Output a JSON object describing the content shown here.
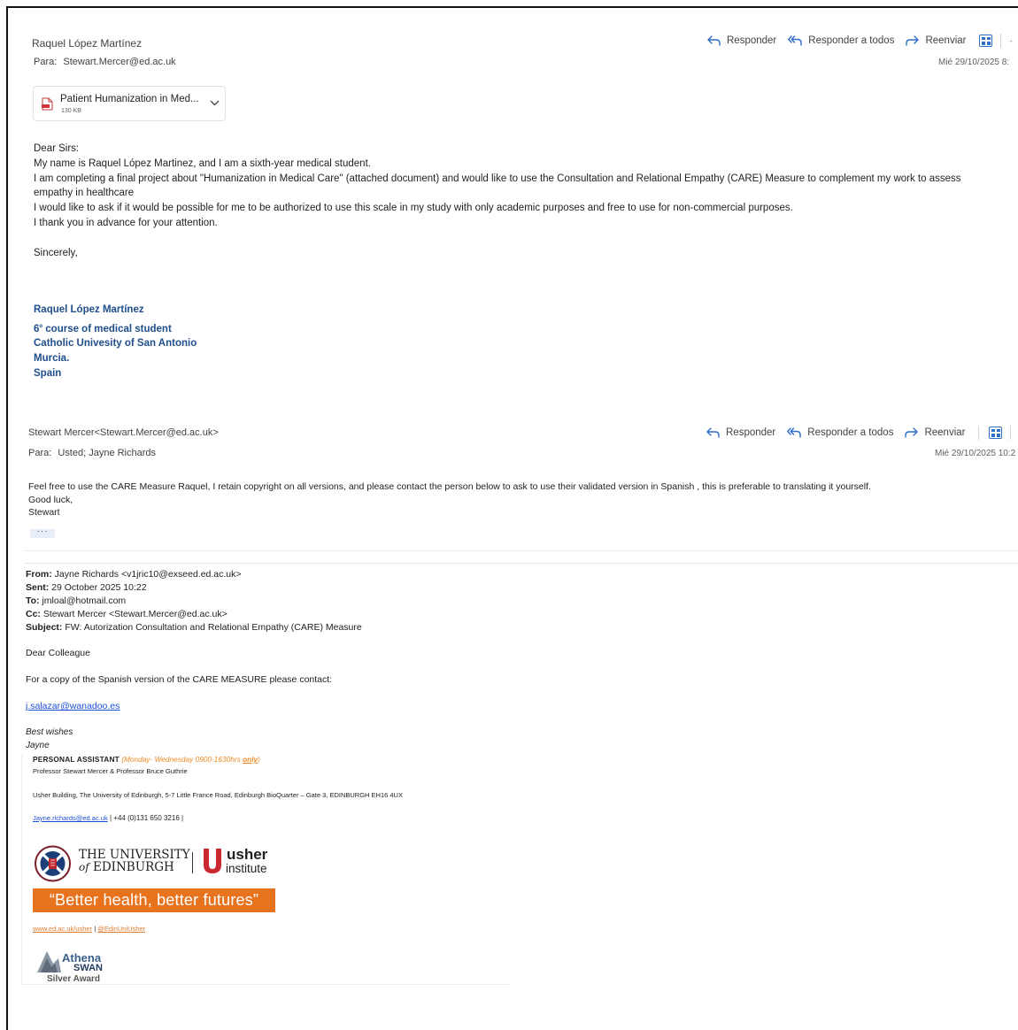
{
  "message1": {
    "sender": "Raquel López Martínez",
    "to_label": "Para:",
    "to": "Stewart.Mercer@ed.ac.uk",
    "date": "Mié 29/10/2025 8:",
    "actions": {
      "reply": "Responder",
      "reply_all": "Responder a todos",
      "forward": "Reenviar"
    },
    "attachment": {
      "name": "Patient Humanization in Med...",
      "size": "130 KB"
    },
    "body": [
      "Dear Sirs:",
      "My name is Raquel López Martinez, and I am a sixth-year medical student.",
      "I am completing a final project about \"Humanization in Medical Care\" (attached document) and would like to use the Consultation and Relational Empathy (CARE) Measure to complement my work to assess empathy in healthcare",
      "I would like to ask if it would be possible for me to be authorized to use this scale in my study with only academic purposes and free to use for non-commercial purposes.",
      "I thank you in advance for your attention."
    ],
    "closing": "Sincerely,",
    "signature": {
      "name": "Raquel López Martínez",
      "course_num": "6",
      "course_sup": "o",
      "course_rest": " course of medical student",
      "university": "Catholic Univesity of San Antonio",
      "city": "Murcia.",
      "country": "Spain"
    }
  },
  "message2": {
    "sender": "Stewart Mercer<Stewart.Mercer@ed.ac.uk>",
    "to_label": "Para:",
    "to": "Usted;  Jayne Richards",
    "date": "Mié 29/10/2025 10:2",
    "actions": {
      "reply": "Responder",
      "reply_all": "Responder a todos",
      "forward": "Reenviar"
    },
    "more": "···",
    "body": [
      "Feel free to use the CARE Measure Raquel, I retain copyright on all versions, and please contact the person below to ask to use their validated version in Spanish , this is preferable to translating it yourself.",
      "Good luck,",
      "Stewart"
    ],
    "expand": "···"
  },
  "quoted": {
    "from_label": "From:",
    "from": " Jayne Richards <v1jric10@exseed.ed.ac.uk>",
    "sent_label": "Sent:",
    "sent": " 29 October 2025 10:22",
    "to_label": "To:",
    "to": " jmloal@hotmail.com",
    "cc_label": "Cc:",
    "cc": " Stewart Mercer <Stewart.Mercer@ed.ac.uk>",
    "subject_label": "Subject:",
    "subject": " FW: Autorization Consultation and Relational Empathy (CARE) Measure",
    "greeting": "Dear Colleague",
    "para": "For a copy of the Spanish version of the CARE MEASURE please contact:",
    "contact_email": "j.salazar@wanadoo.es",
    "wishes": "Best wishes",
    "name": "Jayne",
    "pa_title": "PERSONAL ASSISTANT",
    "pa_hours": " (Monday- Wednesday 0900-1630hrs ",
    "pa_only": "only",
    "pa_close": ")",
    "professors": "Professor Stewart Mercer & Professor Bruce Guthrie",
    "address": "Usher Building, The University of Edinburgh, 5-7 Little France Road, Edinburgh BioQuarter – Gate 3, EDINBURGH EH16 4UX",
    "email": "Jayne.richards@ed.ac.uk",
    "phone": " | +44 (0)131 650 3216 |",
    "logo_the_university": "THE UNIVERSITY",
    "logo_of": "of",
    "logo_edinburgh": " EDINBURGH",
    "logo_usher": "usher",
    "logo_institute": "institute",
    "banner": "“Better health, better futures”",
    "web": "www.ed.ac.uk/usher",
    "web_sep": " | ",
    "twitter": "@EdinUniUsher",
    "athena": "Athena",
    "swan": "SWAN",
    "silver": "Silver Award"
  }
}
